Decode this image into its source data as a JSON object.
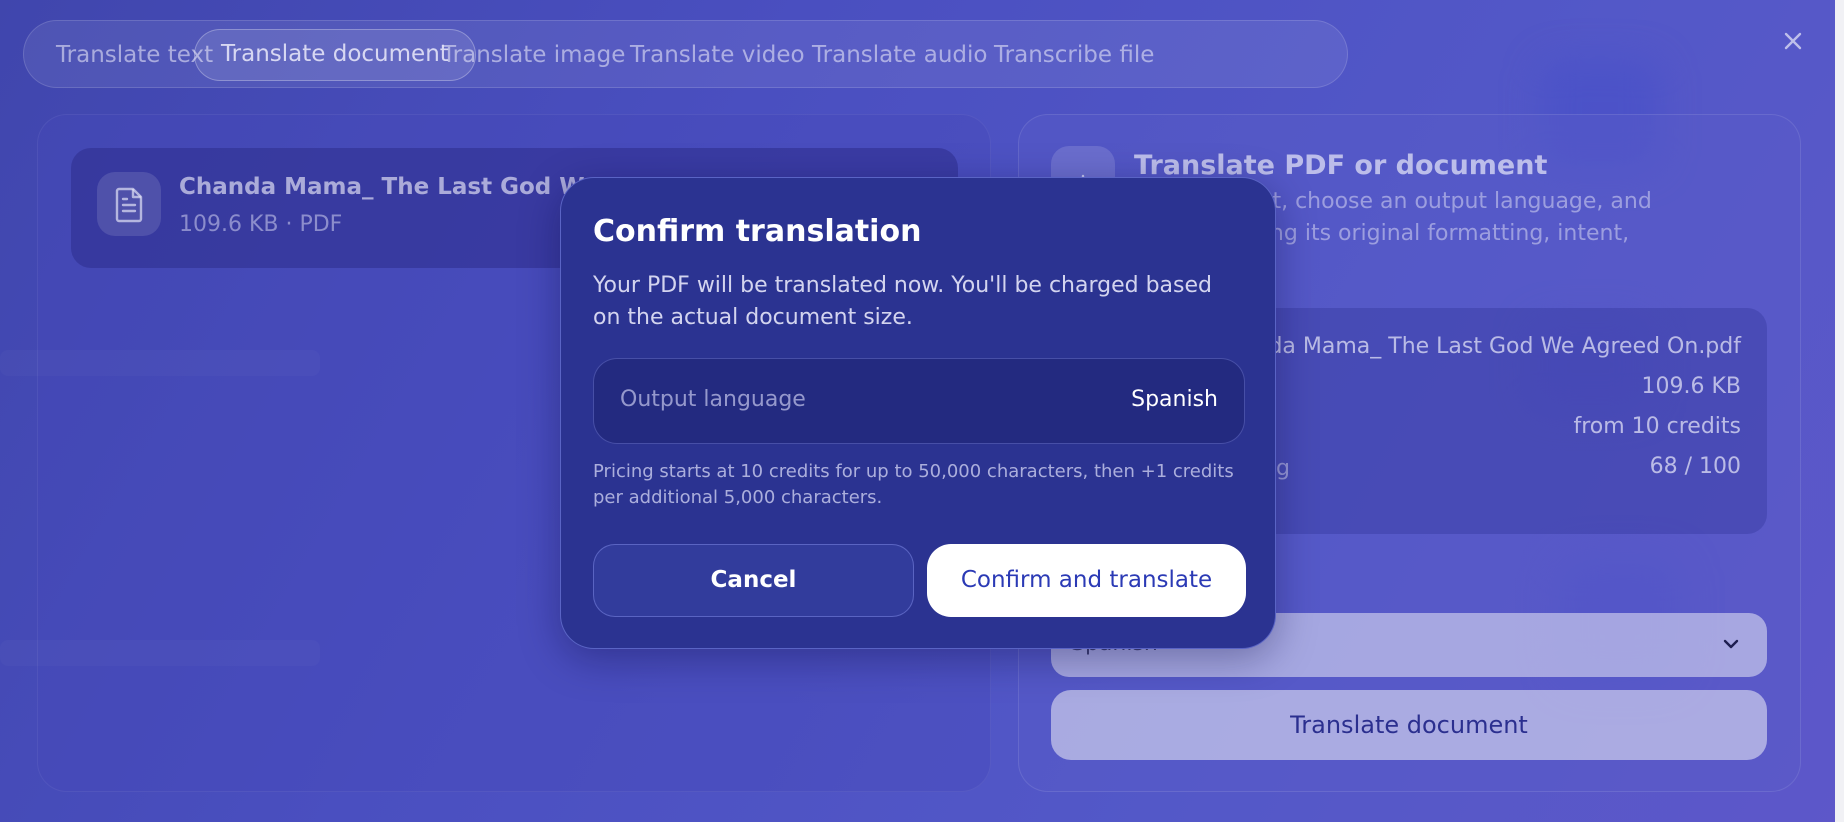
{
  "tabs": [
    {
      "label": "Translate text"
    },
    {
      "label": "Translate document"
    },
    {
      "label": "Translate image"
    },
    {
      "label": "Translate video"
    },
    {
      "label": "Translate audio"
    },
    {
      "label": "Transcribe file"
    }
  ],
  "active_tab": "Translate document",
  "close_icon": "close-icon",
  "file": {
    "name": "Chanda Mama_ The Last God We Ag",
    "meta": "109.6 KB · PDF"
  },
  "panel": {
    "title": "Translate PDF or document",
    "description": "t a document, choose an output language, and\nhile preserving its original formatting, intent,",
    "details": [
      {
        "label": "",
        "value": "nda Mama_ The Last God We Agreed On.pdf"
      },
      {
        "label": "",
        "value": "109.6 KB"
      },
      {
        "label": "",
        "value": "from 10 credits"
      },
      {
        "label": "g",
        "value": "68 / 100"
      }
    ],
    "language_select": "Spanish",
    "translate_button": "Translate document"
  },
  "modal": {
    "title": "Confirm translation",
    "body": "Your PDF will be translated now. You'll be charged based on the actual document size.",
    "output_language_label": "Output language",
    "output_language_value": "Spanish",
    "pricing": "Pricing starts at 10 credits for up to 50,000 characters, then +1 credits per additional 5,000 characters.",
    "cancel_label": "Cancel",
    "confirm_label": "Confirm and translate"
  },
  "colors": {
    "modal_bg": "#2b3391",
    "confirm_text": "#2b3ab5",
    "backdrop": "#4a4fc0"
  }
}
